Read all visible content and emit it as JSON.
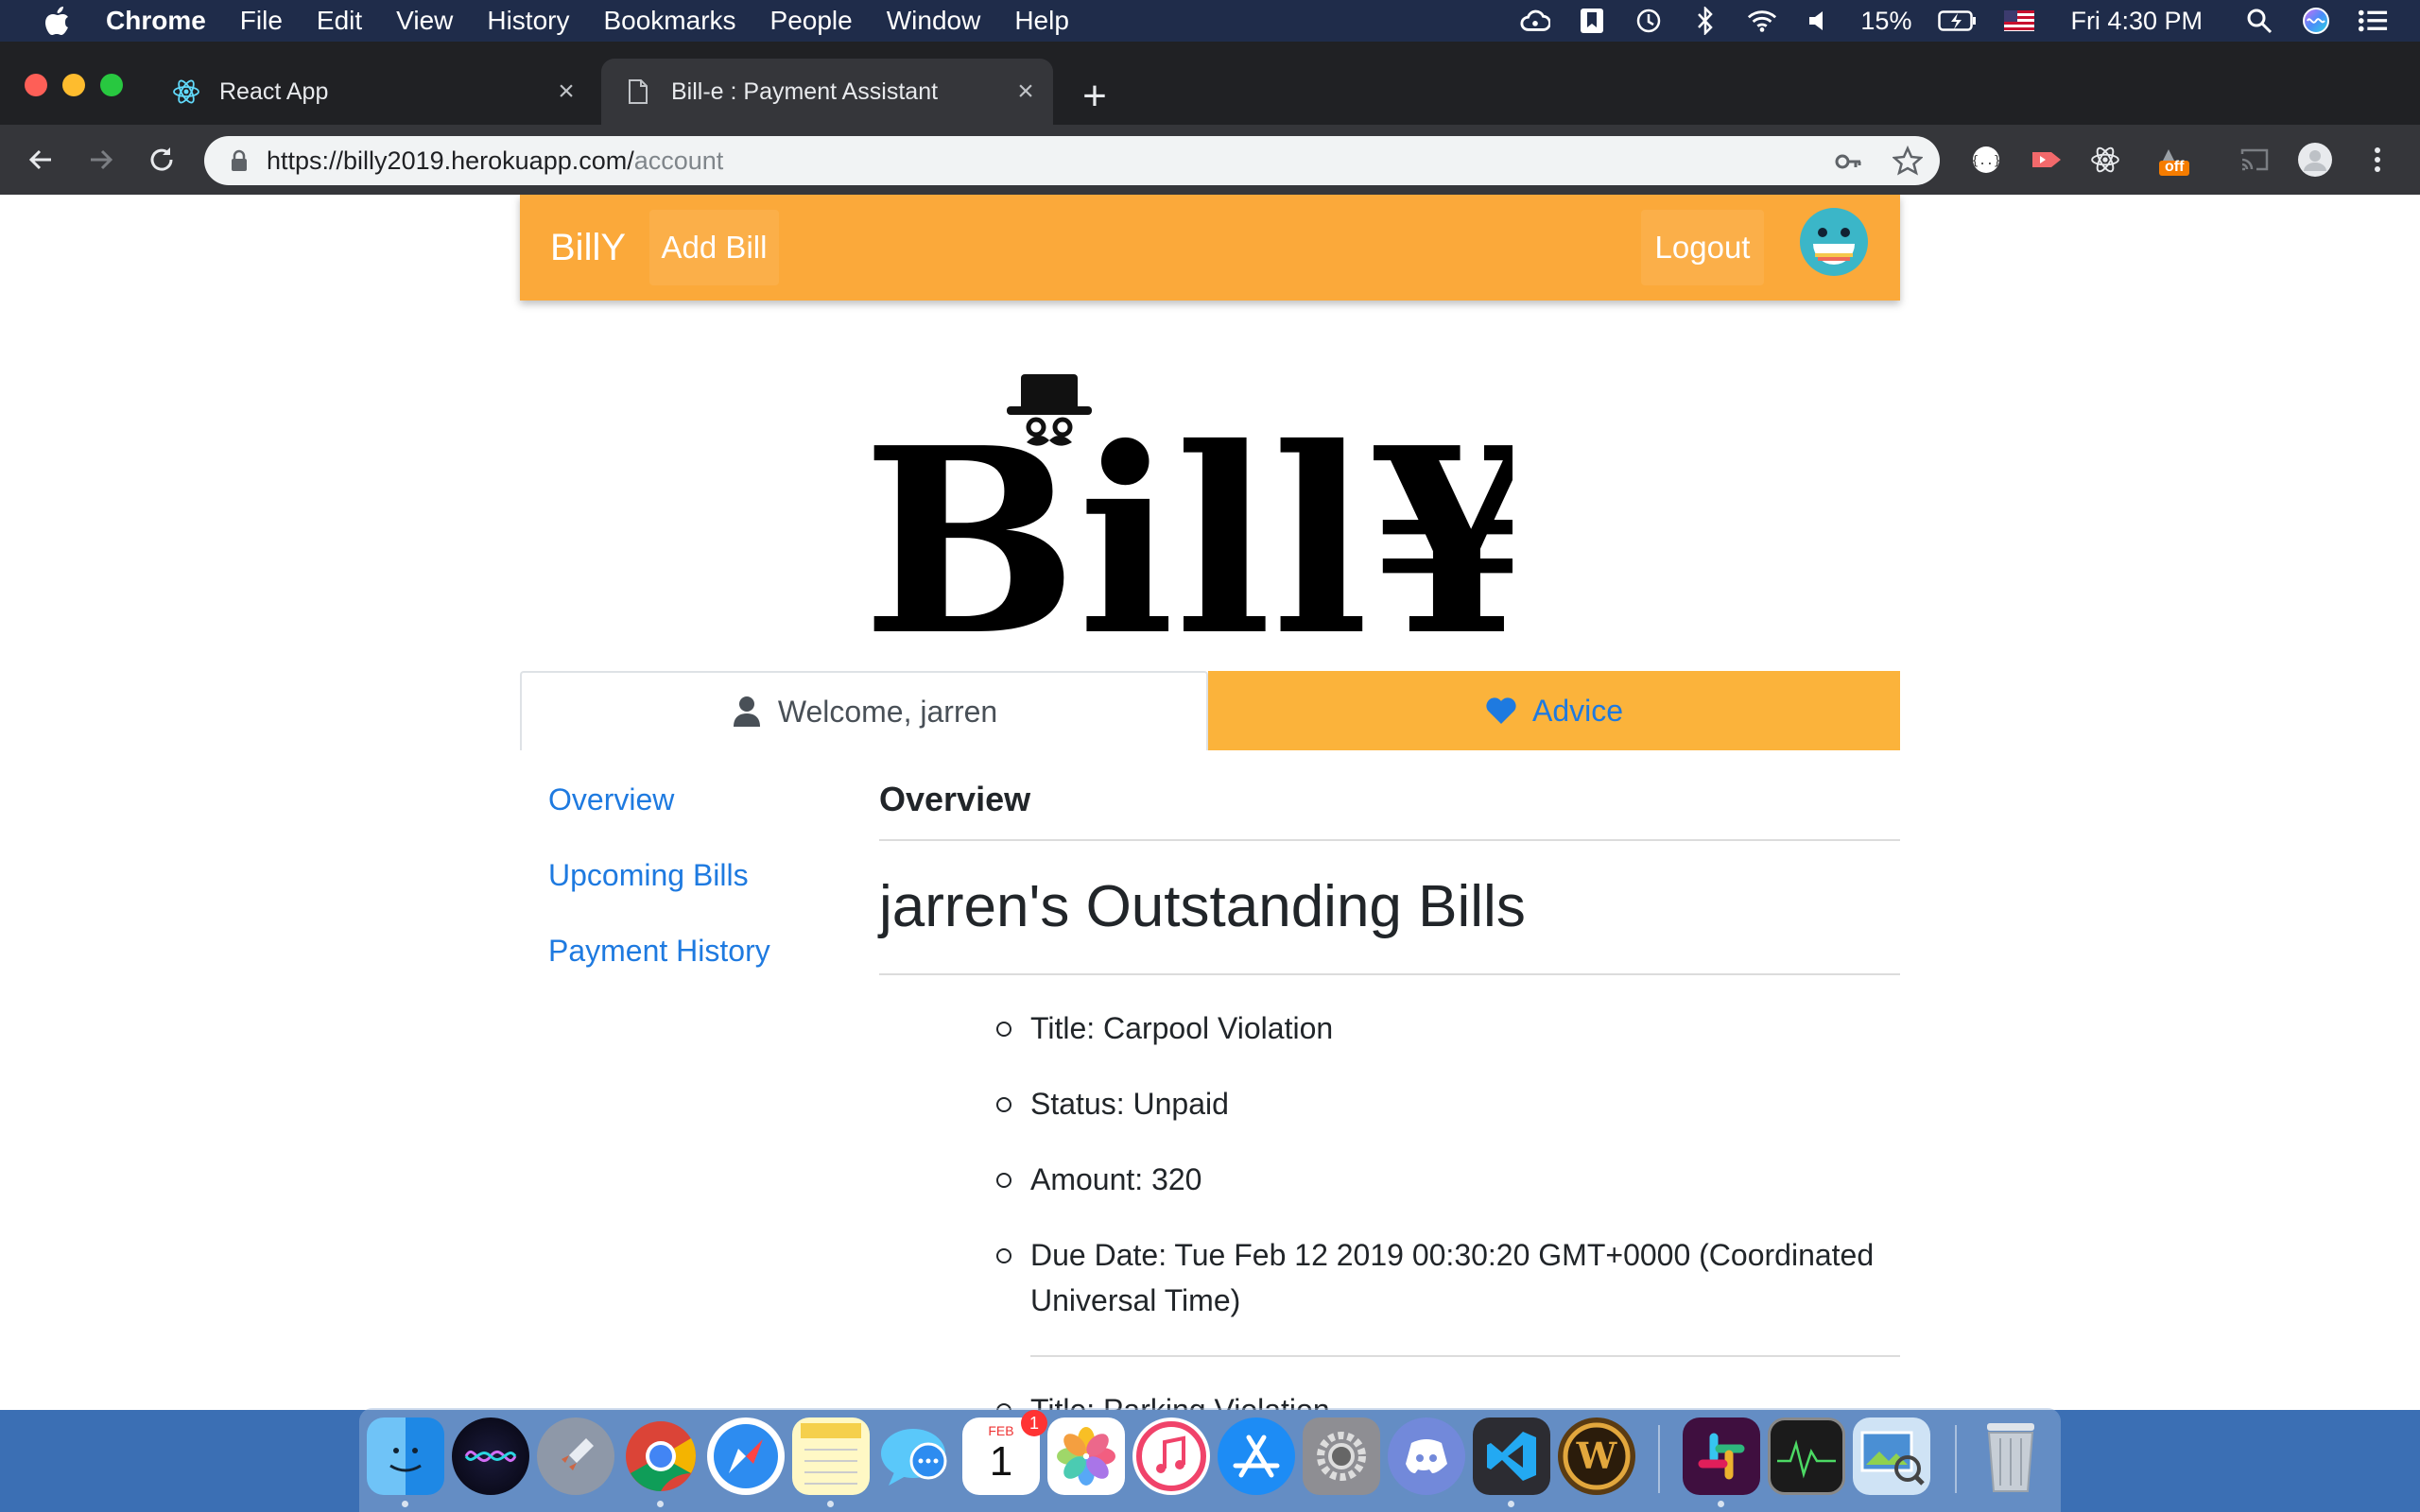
{
  "menubar": {
    "apple_icon": "apple-icon",
    "app_name": "Chrome",
    "items": [
      "File",
      "Edit",
      "View",
      "History",
      "Bookmarks",
      "People",
      "Window",
      "Help"
    ],
    "battery": "15%",
    "clock": "Fri 4:30 PM"
  },
  "browser": {
    "tabs": [
      {
        "title": "React App",
        "icon": "react-icon"
      },
      {
        "title": "Bill-e : Payment Assistant",
        "icon": "page-icon"
      }
    ],
    "url_host": "https://billy2019.herokuapp.com/",
    "url_path": "account",
    "extension_badge": "off"
  },
  "app": {
    "brand": "BillY",
    "add_bill": "Add Bill",
    "logout": "Logout",
    "logo_text": "Bill¥",
    "tabs": {
      "welcome": "Welcome, jarren",
      "advice": "Advice"
    },
    "sidenav": [
      "Overview",
      "Upcoming Bills",
      "Payment History"
    ],
    "section_title": "Overview",
    "bills_heading": "jarren's Outstanding Bills",
    "bills": [
      {
        "title": "Title: Carpool Violation",
        "status": "Status: Unpaid",
        "amount": "Amount: 320",
        "due": "Due Date: Tue Feb 12 2019 00:30:20 GMT+0000 (Coordinated Universal Time)"
      },
      {
        "title": "Title: Parking Violation"
      }
    ]
  },
  "dock": {
    "apps": [
      "Finder",
      "Siri",
      "Launchpad",
      "Chrome",
      "Safari",
      "Notes",
      "Messages",
      "Calendar",
      "Photos",
      "iTunes",
      "App Store",
      "System Preferences",
      "Discord",
      "Visual Studio Code",
      "World of Warcraft",
      "Slack",
      "Activity Monitor",
      "Preview",
      "Trash"
    ],
    "calendar_month": "FEB",
    "calendar_day": "1",
    "calendar_badge": "1"
  },
  "colors": {
    "nav_orange": "#fba93a",
    "advice_tab": "#fbb33b",
    "link_blue": "#1e7ae0"
  }
}
